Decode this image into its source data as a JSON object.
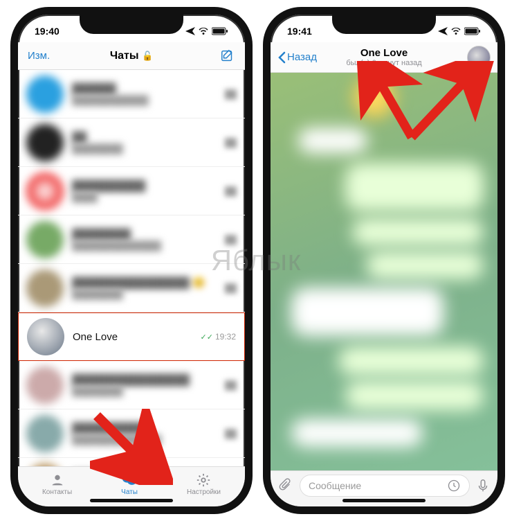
{
  "watermark": "Яблык",
  "left": {
    "status": {
      "time": "19:40"
    },
    "nav": {
      "edit": "Изм.",
      "title": "Чаты",
      "lock_icon": "🔓"
    },
    "focused_chat": {
      "name": "One Love",
      "time": "19:32",
      "ticks": "✓✓"
    },
    "tabs": {
      "contacts": "Контакты",
      "chats": "Чаты",
      "settings": "Настройки",
      "active": "chats"
    }
  },
  "right": {
    "status": {
      "time": "19:41"
    },
    "nav": {
      "back": "Назад",
      "title": "One Love",
      "subtitle": "был(а) 6 минут назад"
    },
    "input": {
      "placeholder": "Сообщение"
    }
  },
  "colors": {
    "accent": "#2481cc",
    "highlight_border": "#d02400",
    "arrow": "#e2231a"
  }
}
